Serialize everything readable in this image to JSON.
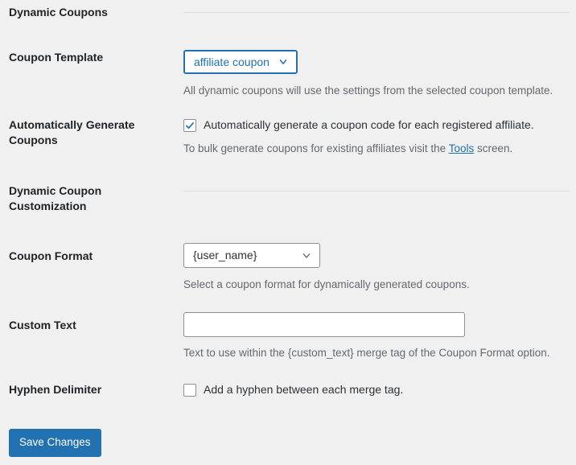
{
  "page": {
    "background_color": "#f0f0f1",
    "accent_color": "#2271b1",
    "label_color": "#1d2327",
    "description_color": "#646970"
  },
  "sections": [
    {
      "id": "dynamic-coupons",
      "heading": "Dynamic Coupons"
    },
    {
      "id": "dynamic-coupon-customization",
      "heading": "Dynamic Coupon Customization"
    }
  ],
  "fields": {
    "coupon_template": {
      "label": "Coupon Template",
      "selected_value": "affiliate coupon",
      "focused": true,
      "description": "All dynamic coupons will use the settings from the selected coupon template."
    },
    "automatically_generate_coupons": {
      "label": "Automatically Generate Coupons",
      "checkbox_label": "Automatically generate a coupon code for each registered affiliate.",
      "checked": true,
      "description_before": "To bulk generate coupons for existing affiliates visit the ",
      "description_link": "Tools",
      "description_after": " screen."
    },
    "coupon_format": {
      "label": "Coupon Format",
      "selected_value": "{user_name}",
      "focused": false,
      "description": "Select a coupon format for dynamically generated coupons."
    },
    "custom_text": {
      "label": "Custom Text",
      "value": "",
      "placeholder": "",
      "description": "Text to use within the {custom_text} merge tag of the Coupon Format option."
    },
    "hyphen_delimiter": {
      "label": "Hyphen Delimiter",
      "checkbox_label": "Add a hyphen between each merge tag.",
      "checked": false
    }
  },
  "actions": {
    "save_label": "Save Changes"
  },
  "icons": {
    "chevron_down": "chevron-down-icon",
    "checkmark": "checkmark-icon"
  }
}
